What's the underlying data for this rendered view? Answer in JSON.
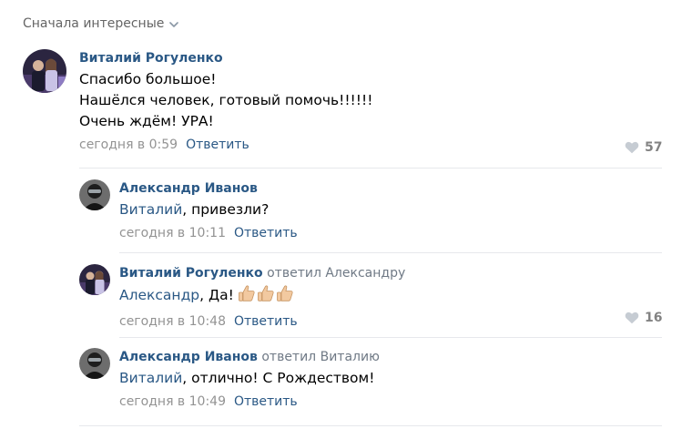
{
  "sort": {
    "label": "Сначала интересные"
  },
  "comments": [
    {
      "author": "Виталий Рогуленко",
      "lines": [
        "Спасибо большое!",
        "Нашёлся человек, готовый помочь!!!!!!",
        "Очень ждём! УРА!"
      ],
      "date": "сегодня в 0:59",
      "reply": "Ответить",
      "likes": "57"
    },
    {
      "author": "Александр Иванов",
      "mention": "Виталий",
      "text": ", привезли?",
      "date": "сегодня в 10:11",
      "reply": "Ответить"
    },
    {
      "author": "Виталий Рогуленко",
      "replied": "ответил",
      "replied_to": "Александру",
      "mention": "Александр",
      "text": ", Да!",
      "emoji": [
        "thumbs-up",
        "thumbs-up",
        "thumbs-up"
      ],
      "date": "сегодня в 10:48",
      "reply": "Ответить",
      "likes": "16"
    },
    {
      "author": "Александр Иванов",
      "replied": "ответил",
      "replied_to": "Виталию",
      "mention": "Виталий",
      "text": ", отлично! С Рождеством!",
      "date": "сегодня в 10:49",
      "reply": "Ответить"
    }
  ],
  "colors": {
    "link": "#2a5885",
    "meta": "#939393",
    "separator": "#e7e8ec",
    "like": "#828282"
  },
  "icons": [
    "chevron-down-icon",
    "heart-icon",
    "thumbs-up-emoji"
  ]
}
